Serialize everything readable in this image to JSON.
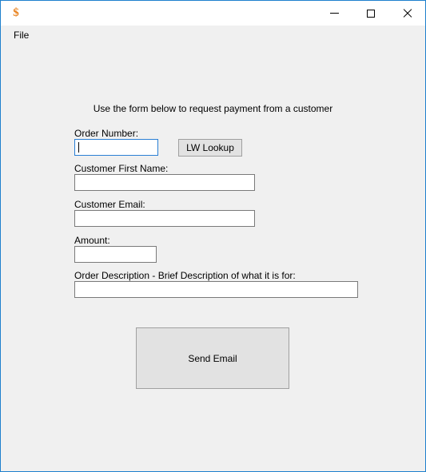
{
  "window": {
    "icon": "dollar-sign-icon",
    "title": "",
    "border_color": "#1e80cd",
    "controls": {
      "minimize": "─",
      "maximize": "□",
      "close": "✕"
    }
  },
  "menubar": {
    "items": [
      {
        "label": "File"
      }
    ]
  },
  "form": {
    "heading": "Use the form below to request payment from a customer",
    "fields": [
      {
        "label": "Order Number:",
        "value": "",
        "placeholder": "",
        "focused": true
      },
      {
        "label": "Customer First Name:",
        "value": "",
        "placeholder": "",
        "focused": false
      },
      {
        "label": "Customer Email:",
        "value": "",
        "placeholder": "",
        "focused": false
      },
      {
        "label": "Amount:",
        "value": "",
        "placeholder": "",
        "focused": false
      },
      {
        "label": "Order Description - Brief Description of what it is for:",
        "value": "",
        "placeholder": "",
        "focused": false
      }
    ],
    "buttons": {
      "lookup": "LW Lookup",
      "send": "Send Email"
    }
  },
  "colors": {
    "accent": "#1e80cd",
    "icon_orange": "#e8821e",
    "surface": "#f0f0f0",
    "button_face": "#e2e2e2",
    "input_border": "#7a7a7a",
    "focus_border": "#2a7fd4"
  }
}
